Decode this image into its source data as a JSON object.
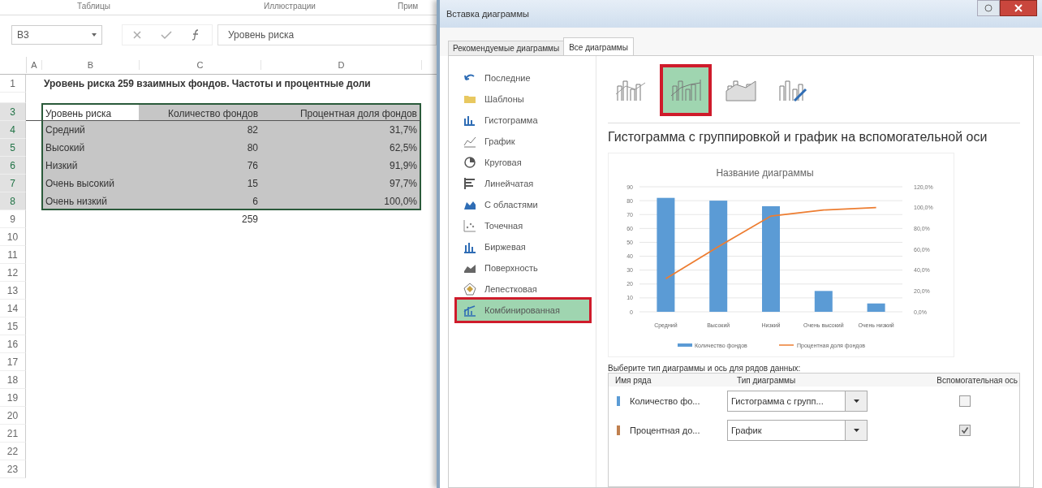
{
  "ribbon_groups": [
    "Таблицы",
    "Иллюстрации",
    "Прим"
  ],
  "formula_bar": {
    "name_box": "B3",
    "value": "Уровень риска"
  },
  "sheet": {
    "columns": [
      "A",
      "B",
      "C",
      "D"
    ],
    "rows": [
      {
        "number": "1",
        "kind": "title",
        "selected": false,
        "cells": {
          "B": "Уровень риска 259 взаимных фондов. Частоты и процентные доли"
        }
      },
      {
        "kind": "spacer",
        "selected": false,
        "cells": {}
      },
      {
        "number": "3",
        "kind": "header",
        "selected": true,
        "cells": {
          "B": "Уровень риска",
          "C": "Количество фондов",
          "D": "Процентная доля фондов"
        }
      },
      {
        "number": "4",
        "kind": "data",
        "selected": true,
        "cells": {
          "B": "Средний",
          "C": "82",
          "D": "31,7%"
        }
      },
      {
        "number": "5",
        "kind": "data",
        "selected": true,
        "cells": {
          "B": "Высокий",
          "C": "80",
          "D": "62,5%"
        }
      },
      {
        "number": "6",
        "kind": "data",
        "selected": true,
        "cells": {
          "B": "Низкий",
          "C": "76",
          "D": "91,9%"
        }
      },
      {
        "number": "7",
        "kind": "data",
        "selected": true,
        "cells": {
          "B": "Очень высокий",
          "C": "15",
          "D": "97,7%"
        }
      },
      {
        "number": "8",
        "kind": "data",
        "selected": true,
        "cells": {
          "B": "Очень низкий",
          "C": "6",
          "D": "100,0%"
        }
      },
      {
        "number": "9",
        "kind": "data",
        "selected": false,
        "cells": {
          "C": "259"
        }
      },
      {
        "number": "10",
        "kind": "data",
        "selected": false,
        "cells": {}
      },
      {
        "number": "11",
        "kind": "data",
        "selected": false,
        "cells": {}
      },
      {
        "number": "12",
        "kind": "data",
        "selected": false,
        "cells": {}
      },
      {
        "number": "13",
        "kind": "data",
        "selected": false,
        "cells": {}
      },
      {
        "number": "14",
        "kind": "data",
        "selected": false,
        "cells": {}
      },
      {
        "number": "15",
        "kind": "data",
        "selected": false,
        "cells": {}
      },
      {
        "number": "16",
        "kind": "data",
        "selected": false,
        "cells": {}
      },
      {
        "number": "17",
        "kind": "data",
        "selected": false,
        "cells": {}
      },
      {
        "number": "18",
        "kind": "data",
        "selected": false,
        "cells": {}
      },
      {
        "number": "19",
        "kind": "data",
        "selected": false,
        "cells": {}
      },
      {
        "number": "20",
        "kind": "data",
        "selected": false,
        "cells": {}
      },
      {
        "number": "21",
        "kind": "data",
        "selected": false,
        "cells": {}
      },
      {
        "number": "22",
        "kind": "data",
        "selected": false,
        "cells": {}
      },
      {
        "number": "23",
        "kind": "data",
        "selected": false,
        "cells": {}
      }
    ]
  },
  "dialog": {
    "title": "Вставка диаграммы",
    "tabs": [
      {
        "label": "Рекомендуемые диаграммы",
        "selected": false
      },
      {
        "label": "Все диаграммы",
        "selected": true
      }
    ],
    "categories": [
      {
        "label": "Последние",
        "kind": "recent",
        "selected": false
      },
      {
        "label": "Шаблоны",
        "kind": "templates",
        "selected": false
      },
      {
        "label": "Гистограмма",
        "kind": "column",
        "selected": false
      },
      {
        "label": "График",
        "kind": "line",
        "selected": false
      },
      {
        "label": "Круговая",
        "kind": "pie",
        "selected": false
      },
      {
        "label": "Линейчатая",
        "kind": "bar",
        "selected": false
      },
      {
        "label": "С областями",
        "kind": "area",
        "selected": false
      },
      {
        "label": "Точечная",
        "kind": "scatter",
        "selected": false
      },
      {
        "label": "Биржевая",
        "kind": "stock",
        "selected": false
      },
      {
        "label": "Поверхность",
        "kind": "surface",
        "selected": false
      },
      {
        "label": "Лепестковая",
        "kind": "radar",
        "selected": false
      },
      {
        "label": "Комбинированная",
        "kind": "combo",
        "selected": true
      }
    ],
    "subtypes": [
      {
        "kind": "column-line",
        "selected": false
      },
      {
        "kind": "column-line-secondary",
        "selected": true
      },
      {
        "kind": "area-column",
        "selected": false
      },
      {
        "kind": "custom",
        "selected": false
      }
    ],
    "subtype_title": "Гистограмма с группировкой и график на вспомогательной оси",
    "preview": {
      "columns": {
        "chart_data": {
          "type": "bar",
          "title": "Название диаграммы",
          "grid": true,
          "categories": [
            "Средний",
            "Высокий",
            "Низкий",
            "Очень высокий",
            "Очень низкий"
          ],
          "series": [
            {
              "name": "Количество фондов",
              "color": "#5b9bd5",
              "values": [
                82,
                80,
                76,
                15,
                6
              ]
            }
          ],
          "ylim": [
            0,
            90
          ],
          "yticks": [
            {
              "value": 0,
              "label": "0"
            },
            {
              "value": 10,
              "label": "10"
            },
            {
              "value": 20,
              "label": "20"
            },
            {
              "value": 30,
              "label": "30"
            },
            {
              "value": 40,
              "label": "40"
            },
            {
              "value": 50,
              "label": "50"
            },
            {
              "value": 60,
              "label": "60"
            },
            {
              "value": 70,
              "label": "70"
            },
            {
              "value": 80,
              "label": "80"
            },
            {
              "value": 90,
              "label": "90"
            }
          ]
        }
      },
      "share_line": {
        "chart_data": {
          "type": "line",
          "categories": [
            null,
            null,
            null,
            null,
            null
          ],
          "series": [
            {
              "name": "Процентная доля фондов",
              "color": "#ed7d31",
              "values": [
                31.7,
                62.5,
                91.9,
                97.7,
                100
              ]
            }
          ],
          "ylim": [
            0,
            120
          ],
          "yticks": [
            {
              "value": 0,
              "label": "0,0%"
            },
            {
              "value": 20,
              "label": "20,0%"
            },
            {
              "value": 40,
              "label": "40,0%"
            },
            {
              "value": 60,
              "label": "60,0%"
            },
            {
              "value": 80,
              "label": "80,0%"
            },
            {
              "value": 100,
              "label": "100,0%"
            },
            {
              "value": 120,
              "label": "120,0%"
            }
          ]
        }
      }
    },
    "series_prompt": "Выберите тип диаграммы и ось для рядов данных:",
    "series_table": {
      "columns": [
        "Имя ряда",
        "Тип диаграммы",
        "Вспомогательная ось"
      ],
      "rows": [
        {
          "name": "Количество фо...",
          "color": "#5b9bd5",
          "chart_type": "Гистограмма с групп...",
          "secondary_axis": false
        },
        {
          "name": "Процентная до...",
          "color": "#c0804f",
          "chart_type": "График",
          "secondary_axis": true
        }
      ]
    }
  }
}
